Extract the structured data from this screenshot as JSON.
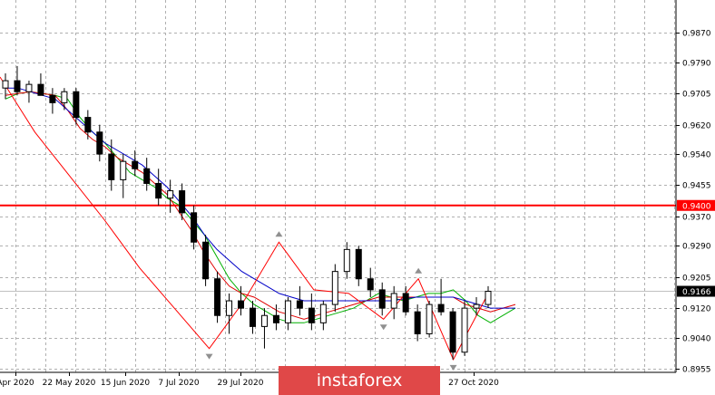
{
  "chart_data": {
    "type": "candlestick",
    "instrument_note": "",
    "y_ticks": [
      "0.9870",
      "0.9790",
      "0.9705",
      "0.9620",
      "0.9540",
      "0.9455",
      "0.9370",
      "0.9290",
      "0.9205",
      "0.9120",
      "0.9040",
      "0.8955"
    ],
    "y_tick_values": [
      0.987,
      0.979,
      0.9705,
      0.962,
      0.954,
      0.9455,
      0.937,
      0.929,
      0.9205,
      0.912,
      0.904,
      0.8955
    ],
    "ylim": [
      0.8945,
      0.996
    ],
    "x_ticks": [
      "Apr 2020",
      "22 May 2020",
      "15 Jun 2020",
      "7 Jul 2020",
      "29 Jul 2020",
      "27 Oct 2020"
    ],
    "horizontal_level": {
      "value": 0.94,
      "label": "0.9400",
      "color": "#ff0000"
    },
    "current_price": {
      "value": 0.9166,
      "label": "0.9166",
      "color": "#000000"
    },
    "series": [
      {
        "name": "",
        "color": "#00b000",
        "role": "fast moving average",
        "values": [
          0.969,
          0.9705,
          0.971,
          0.9705,
          0.97,
          0.969,
          0.964,
          0.96,
          0.957,
          0.953,
          0.949,
          0.947,
          0.945,
          0.942,
          0.94,
          0.936,
          0.932,
          0.926,
          0.92,
          0.916,
          0.913,
          0.911,
          0.909,
          0.908,
          0.908,
          0.909,
          0.91,
          0.911,
          0.912,
          0.914,
          0.916,
          0.915,
          0.914,
          0.915,
          0.916,
          0.916,
          0.917,
          0.914,
          0.91,
          0.908,
          0.91,
          0.912
        ]
      },
      {
        "name": "",
        "color": "#e00000",
        "role": "medium moving average",
        "values": [
          0.97,
          0.9705,
          0.971,
          0.9705,
          0.97,
          0.966,
          0.961,
          0.958,
          0.956,
          0.953,
          0.951,
          0.949,
          0.946,
          0.943,
          0.938,
          0.933,
          0.927,
          0.922,
          0.918,
          0.916,
          0.915,
          0.913,
          0.911,
          0.91,
          0.909,
          0.91,
          0.911,
          0.912,
          0.913,
          0.914,
          0.915,
          0.915,
          0.915,
          0.915,
          0.915,
          0.915,
          0.915,
          0.913,
          0.912,
          0.911,
          0.912,
          0.913
        ]
      },
      {
        "name": "",
        "color": "#0000c8",
        "role": "slow moving average",
        "values": [
          0.972,
          0.972,
          0.971,
          0.97,
          0.969,
          0.966,
          0.963,
          0.96,
          0.957,
          0.955,
          0.953,
          0.951,
          0.948,
          0.945,
          0.941,
          0.937,
          0.932,
          0.928,
          0.925,
          0.922,
          0.92,
          0.918,
          0.916,
          0.915,
          0.914,
          0.914,
          0.914,
          0.914,
          0.914,
          0.914,
          0.914,
          0.914,
          0.9145,
          0.915,
          0.915,
          0.915,
          0.915,
          0.914,
          0.913,
          0.912,
          0.912,
          0.912
        ]
      },
      {
        "name": "",
        "color": "#ff0000",
        "role": "zigzag",
        "values": [
          0.975,
          0.96,
          0.948,
          0.936,
          0.923,
          0.912,
          0.901,
          0.914,
          0.93,
          0.917,
          0.916,
          0.909,
          0.92,
          0.898,
          0.916
        ]
      }
    ],
    "candles": [
      [
        0.972,
        0.976,
        0.969,
        0.974
      ],
      [
        0.974,
        0.978,
        0.97,
        0.971
      ],
      [
        0.971,
        0.974,
        0.968,
        0.973
      ],
      [
        0.973,
        0.976,
        0.97,
        0.97
      ],
      [
        0.97,
        0.972,
        0.965,
        0.968
      ],
      [
        0.968,
        0.972,
        0.966,
        0.971
      ],
      [
        0.971,
        0.972,
        0.962,
        0.964
      ],
      [
        0.964,
        0.966,
        0.958,
        0.96
      ],
      [
        0.96,
        0.962,
        0.952,
        0.954
      ],
      [
        0.954,
        0.958,
        0.944,
        0.947
      ],
      [
        0.947,
        0.954,
        0.942,
        0.952
      ],
      [
        0.952,
        0.955,
        0.948,
        0.95
      ],
      [
        0.95,
        0.953,
        0.944,
        0.946
      ],
      [
        0.946,
        0.95,
        0.94,
        0.942
      ],
      [
        0.942,
        0.947,
        0.938,
        0.944
      ],
      [
        0.944,
        0.946,
        0.936,
        0.938
      ],
      [
        0.938,
        0.94,
        0.928,
        0.93
      ],
      [
        0.93,
        0.932,
        0.918,
        0.92
      ],
      [
        0.92,
        0.922,
        0.908,
        0.91
      ],
      [
        0.91,
        0.916,
        0.905,
        0.914
      ],
      [
        0.914,
        0.918,
        0.91,
        0.912
      ],
      [
        0.912,
        0.914,
        0.905,
        0.907
      ],
      [
        0.907,
        0.912,
        0.901,
        0.91
      ],
      [
        0.91,
        0.913,
        0.906,
        0.908
      ],
      [
        0.908,
        0.915,
        0.906,
        0.914
      ],
      [
        0.914,
        0.918,
        0.91,
        0.912
      ],
      [
        0.912,
        0.916,
        0.906,
        0.908
      ],
      [
        0.908,
        0.914,
        0.906,
        0.913
      ],
      [
        0.913,
        0.924,
        0.911,
        0.922
      ],
      [
        0.922,
        0.93,
        0.92,
        0.928
      ],
      [
        0.928,
        0.929,
        0.918,
        0.92
      ],
      [
        0.92,
        0.923,
        0.915,
        0.917
      ],
      [
        0.917,
        0.919,
        0.91,
        0.912
      ],
      [
        0.912,
        0.918,
        0.909,
        0.916
      ],
      [
        0.916,
        0.918,
        0.91,
        0.911
      ],
      [
        0.911,
        0.913,
        0.903,
        0.905
      ],
      [
        0.905,
        0.914,
        0.904,
        0.913
      ],
      [
        0.913,
        0.92,
        0.91,
        0.911
      ],
      [
        0.911,
        0.912,
        0.898,
        0.9
      ],
      [
        0.9,
        0.914,
        0.899,
        0.912
      ],
      [
        0.912,
        0.915,
        0.91,
        0.913
      ],
      [
        0.913,
        0.918,
        0.912,
        0.9166
      ]
    ]
  },
  "watermark": {
    "text": "instaforex",
    "bg_color": "#e04848"
  }
}
